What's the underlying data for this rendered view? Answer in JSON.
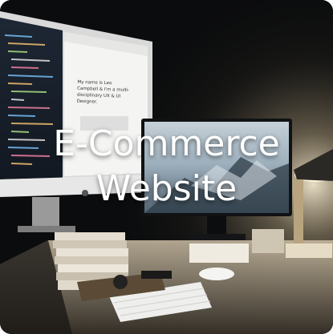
{
  "card": {
    "title_line1": "E-Commerce",
    "title_line2": "Website"
  },
  "left_monitor": {
    "page_text": "My name is Leo Campbell & I'm a multi-disciplinary UX & UI Designer.",
    "highlight": "Leo Campbell"
  },
  "colors": {
    "background": "#0b0c0d",
    "title": "#ffffff",
    "lamp_glow": "#f6e6c4",
    "link_blue": "#2d7be8"
  }
}
